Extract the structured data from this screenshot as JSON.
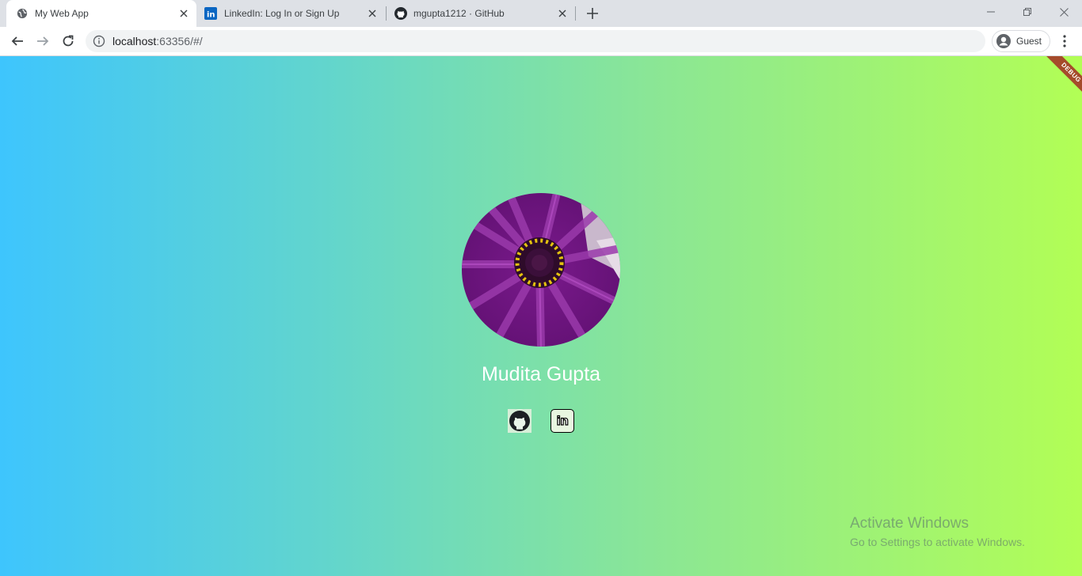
{
  "browser": {
    "tabs": [
      {
        "title": "My Web App",
        "favicon": "globe-icon",
        "active": true
      },
      {
        "title": "LinkedIn: Log In or Sign Up",
        "favicon": "linkedin-icon",
        "active": false
      },
      {
        "title": "mgupta1212 · GitHub",
        "favicon": "github-icon",
        "active": false
      }
    ],
    "url": {
      "host": "localhost",
      "rest": ":63356/#/"
    },
    "profile_label": "Guest"
  },
  "app": {
    "debug_label": "DEBUG",
    "person_name": "Mudita Gupta",
    "social_links": [
      {
        "name": "github",
        "icon": "github-icon"
      },
      {
        "name": "linkedin",
        "icon": "linkedin-icon",
        "text": "in"
      }
    ],
    "background_colors": [
      "#3ec5fd",
      "#b2fe55"
    ]
  },
  "os_watermark": {
    "title": "Activate Windows",
    "subtitle": "Go to Settings to activate Windows."
  }
}
